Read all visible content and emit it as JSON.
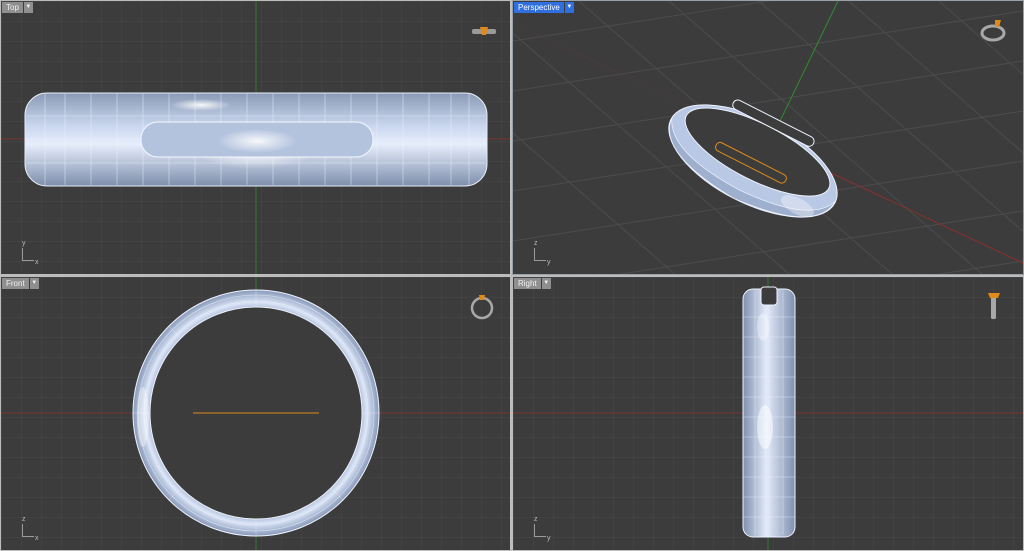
{
  "viewports": {
    "top": {
      "title": "Top",
      "menu_icon": "chevron-down-icon",
      "axes": {
        "y": "y",
        "x": "x"
      },
      "nav_icon": "ring-top-view-icon"
    },
    "perspective": {
      "title": "Perspective",
      "menu_icon": "chevron-down-icon",
      "active": true,
      "axes": {
        "z": "z",
        "y": "y"
      },
      "nav_icon": "ring-perspective-icon"
    },
    "front": {
      "title": "Front",
      "menu_icon": "chevron-down-icon",
      "axes": {
        "z": "z",
        "x": "x"
      },
      "nav_icon": "ring-front-view-icon"
    },
    "right": {
      "title": "Right",
      "menu_icon": "chevron-down-icon",
      "axes": {
        "z": "z",
        "y": "y"
      },
      "nav_icon": "ring-side-view-icon"
    }
  },
  "colors": {
    "viewport_bg": "#3c3c3c",
    "grid": "#4a4a4a",
    "grid_major": "#555555",
    "x_axis": "#8a2f2f",
    "y_axis": "#2f7a2f",
    "active_title": "#2f6fe0",
    "ring_fill": "#c3d2ea",
    "wire": "#f2f6ff",
    "accent": "#e08a1a"
  }
}
